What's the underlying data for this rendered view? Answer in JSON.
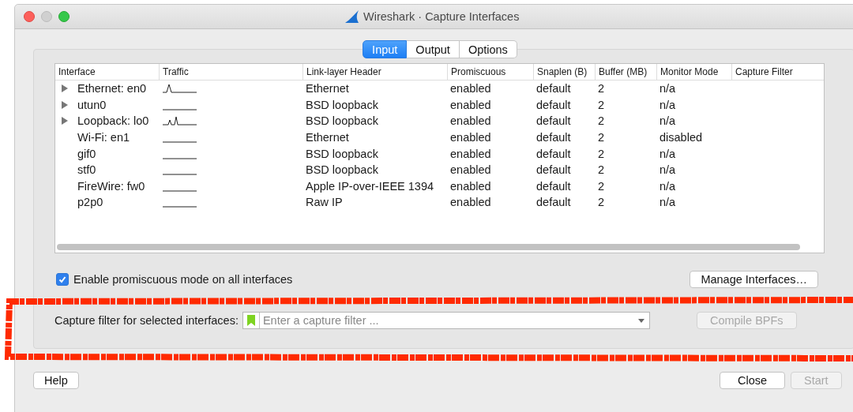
{
  "window": {
    "title": "Wireshark · Capture Interfaces"
  },
  "tabs": [
    {
      "label": "Input",
      "selected": true
    },
    {
      "label": "Output",
      "selected": false
    },
    {
      "label": "Options",
      "selected": false
    }
  ],
  "table": {
    "columns": [
      "Interface",
      "Traffic",
      "Link-layer Header",
      "Promiscuous",
      "Snaplen (B)",
      "Buffer (MB)",
      "Monitor Mode",
      "Capture Filter"
    ],
    "rows": [
      {
        "interface": "Ethernet: en0",
        "expandable": true,
        "kind": "spike",
        "link": "Ethernet",
        "promiscuous": "enabled",
        "snaplen": "default",
        "buffer": "2",
        "monitor": "n/a"
      },
      {
        "interface": "utun0",
        "expandable": true,
        "kind": "flat",
        "link": "BSD loopback",
        "promiscuous": "enabled",
        "snaplen": "default",
        "buffer": "2",
        "monitor": "n/a"
      },
      {
        "interface": "Loopback: lo0",
        "expandable": true,
        "kind": "twin",
        "link": "BSD loopback",
        "promiscuous": "enabled",
        "snaplen": "default",
        "buffer": "2",
        "monitor": "n/a"
      },
      {
        "interface": "Wi-Fi: en1",
        "expandable": false,
        "kind": "flat",
        "link": "Ethernet",
        "promiscuous": "enabled",
        "snaplen": "default",
        "buffer": "2",
        "monitor": "disabled"
      },
      {
        "interface": "gif0",
        "expandable": false,
        "kind": "flat",
        "link": "BSD loopback",
        "promiscuous": "enabled",
        "snaplen": "default",
        "buffer": "2",
        "monitor": "n/a"
      },
      {
        "interface": "stf0",
        "expandable": false,
        "kind": "flat",
        "link": "BSD loopback",
        "promiscuous": "enabled",
        "snaplen": "default",
        "buffer": "2",
        "monitor": "n/a"
      },
      {
        "interface": "FireWire: fw0",
        "expandable": false,
        "kind": "flat",
        "link": "Apple IP-over-IEEE 1394",
        "promiscuous": "enabled",
        "snaplen": "default",
        "buffer": "2",
        "monitor": "n/a"
      },
      {
        "interface": "p2p0",
        "expandable": false,
        "kind": "flat",
        "link": "Raw IP",
        "promiscuous": "enabled",
        "snaplen": "default",
        "buffer": "2",
        "monitor": "n/a"
      }
    ]
  },
  "promiscuous_all": {
    "label": "Enable promiscuous mode on all interfaces",
    "checked": true
  },
  "manage_button": {
    "label": "Manage Interfaces…",
    "disabled": false
  },
  "capture_filter": {
    "label": "Capture filter for selected interfaces:",
    "placeholder": "Enter a capture filter ..."
  },
  "compile_button": {
    "label": "Compile BPFs",
    "disabled": true
  },
  "buttons": [
    {
      "label": "Help",
      "disabled": false
    },
    {
      "label": "Close",
      "disabled": false
    },
    {
      "label": "Start",
      "disabled": true
    }
  ]
}
